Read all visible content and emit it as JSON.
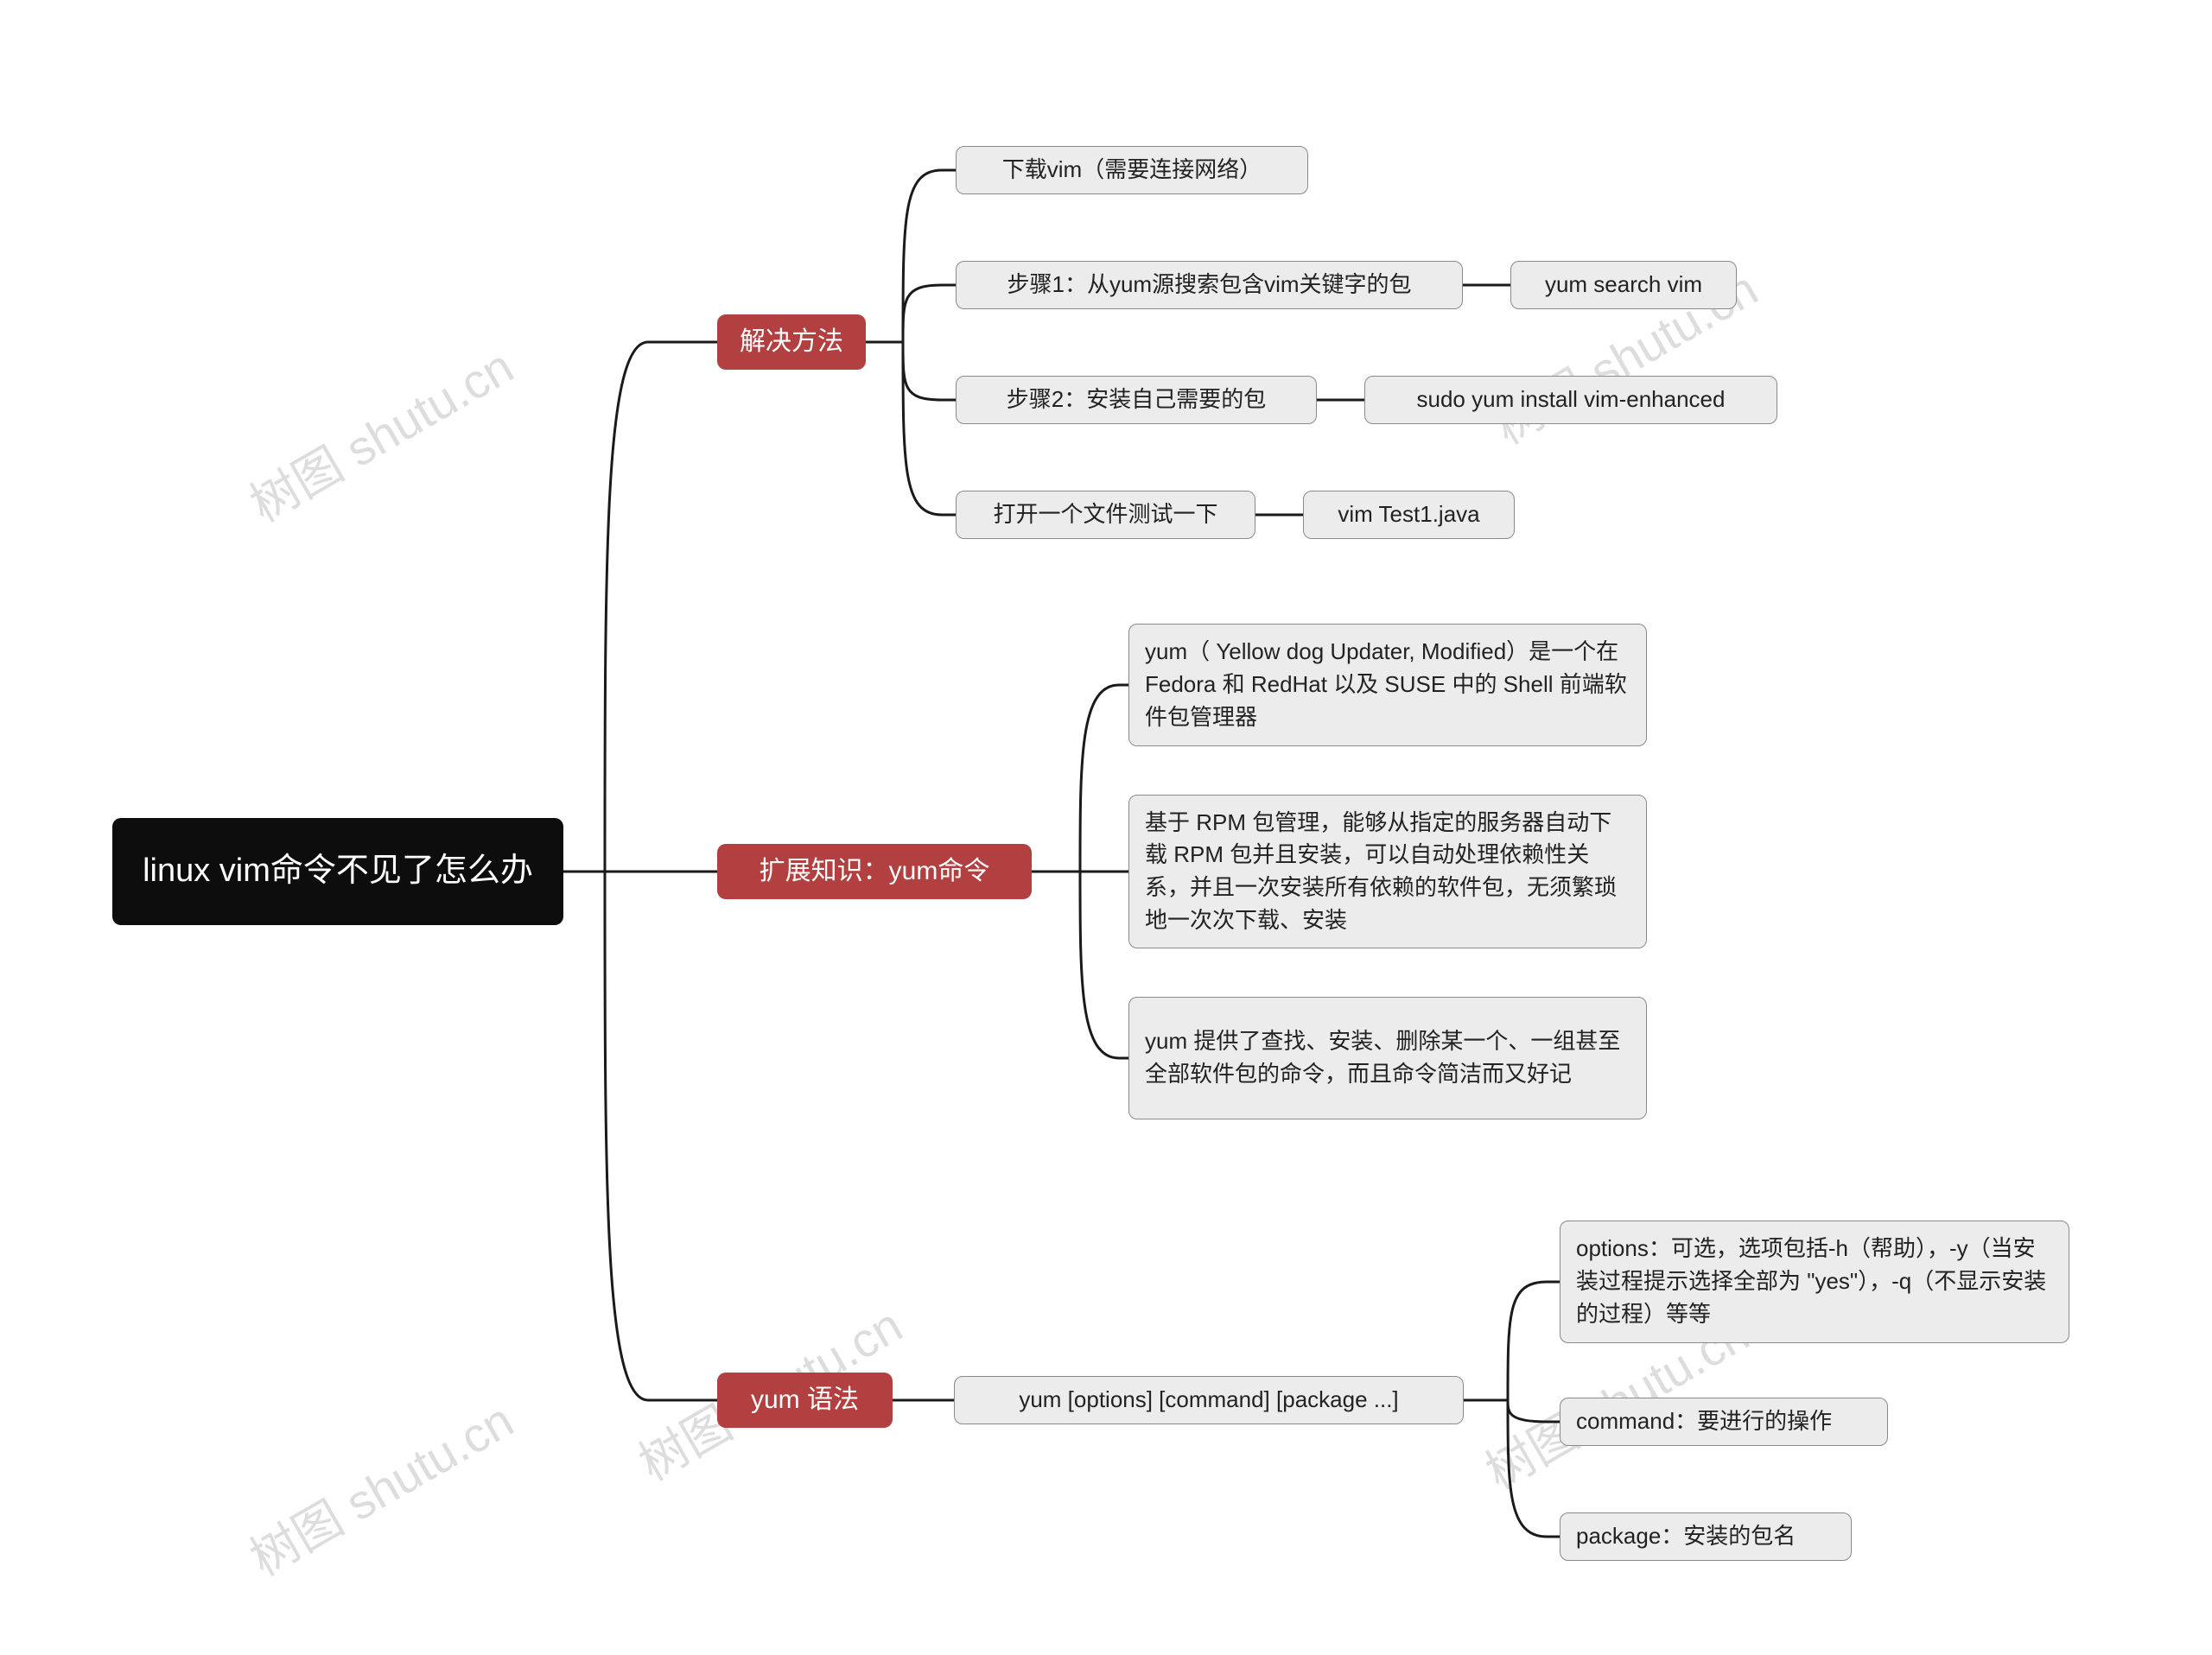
{
  "root": {
    "title": "linux vim命令不见了怎么办"
  },
  "branches": {
    "solution": {
      "label": "解决方法",
      "items": {
        "download": "下载vim（需要连接网络）",
        "step1": "步骤1：从yum源搜索包含vim关键字的包",
        "step1_cmd": "yum search vim",
        "step2": "步骤2：安装自己需要的包",
        "step2_cmd": "sudo yum install vim-enhanced",
        "test": "打开一个文件测试一下",
        "test_cmd": "vim Test1.java"
      }
    },
    "extend": {
      "label": "扩展知识：yum命令",
      "items": {
        "desc1": "yum（ Yellow dog Updater, Modified）是一个在 Fedora 和 RedHat 以及 SUSE 中的 Shell 前端软件包管理器",
        "desc2": "基于 RPM 包管理，能够从指定的服务器自动下载 RPM 包并且安装，可以自动处理依赖性关系，并且一次安装所有依赖的软件包，无须繁琐地一次次下载、安装",
        "desc3": "yum 提供了查找、安装、删除某一个、一组甚至全部软件包的命令，而且命令简洁而又好记"
      }
    },
    "syntax": {
      "label": "yum 语法",
      "usage": "yum [options] [command] [package ...]",
      "items": {
        "options": "options：可选，选项包括-h（帮助），-y（当安装过程提示选择全部为 \"yes\"），-q（不显示安装的过程）等等",
        "command": "command：要进行的操作",
        "package": "package：安装的包名"
      }
    }
  },
  "watermark": "树图 shutu.cn"
}
